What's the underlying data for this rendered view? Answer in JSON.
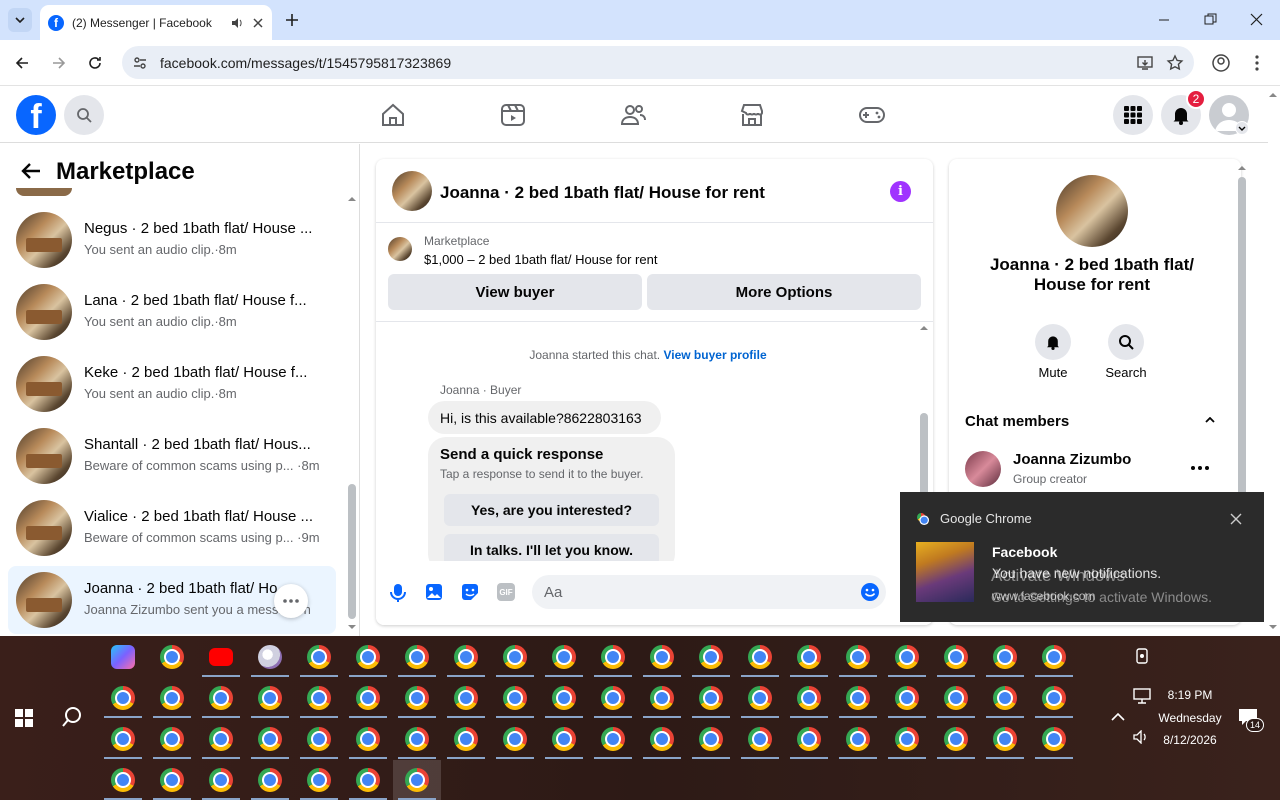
{
  "browser": {
    "tab_title": "(2) Messenger | Facebook",
    "url": "facebook.com/messages/t/1545795817323869"
  },
  "fbnav": {
    "notification_count": "2"
  },
  "left": {
    "title": "Marketplace",
    "conversations": [
      {
        "name": "Negus · 2 bed 1bath flat/ House ...",
        "sub": "You sent an audio clip.·8m"
      },
      {
        "name": "Lana · 2 bed 1bath flat/ House f...",
        "sub": "You sent an audio clip.·8m"
      },
      {
        "name": "Keke · 2 bed 1bath flat/ House f...",
        "sub": "You sent an audio clip.·8m"
      },
      {
        "name": "Shantall · 2 bed 1bath flat/ Hous...",
        "sub": "Beware of common scams using p... ·8m"
      },
      {
        "name": "Vialice · 2 bed 1bath flat/ House ...",
        "sub": "Beware of common scams using p... ·9m"
      },
      {
        "name": "Joanna · 2 bed 1bath flat/ Ho...",
        "sub": "Joanna Zizumbo sent you a messa...9h"
      }
    ]
  },
  "chat": {
    "header_title": "Joanna · 2 bed 1bath flat/ House for rent",
    "listing_label": "Marketplace",
    "listing_title": "$1,000 – 2 bed 1bath flat/ House for rent",
    "view_buyer": "View buyer",
    "more_options": "More Options",
    "started_text": "Joanna started this chat.",
    "view_profile": "View buyer profile",
    "sender_label": "Joanna · Buyer",
    "message": "Hi, is this available?8622803163",
    "quick_title": "Send a quick response",
    "quick_sub": "Tap a response to send it to the buyer.",
    "quick_1": "Yes, are you interested?",
    "quick_2": "In talks. I'll let you know.",
    "input_placeholder": "Aa"
  },
  "right": {
    "title": "Joanna · 2 bed 1bath flat/ House for rent",
    "mute": "Mute",
    "search": "Search",
    "members_header": "Chat members",
    "member_name": "Joanna Zizumbo",
    "member_role": "Group creator"
  },
  "toast": {
    "app": "Google Chrome",
    "title": "Facebook",
    "body": "You have new notifications.",
    "source": "www.facebook.com",
    "watermark_1": "Activate Windows",
    "watermark_2": "Go to Settings to activate Windows."
  },
  "taskbar": {
    "time": "8:19 PM",
    "day": "Wednesday",
    "date": "8/12/2026",
    "notif_count": "14"
  },
  "colors": {
    "facebook_blue": "#0866ff",
    "badge_red": "#e41e3f",
    "accent_purple": "#a033ff"
  }
}
